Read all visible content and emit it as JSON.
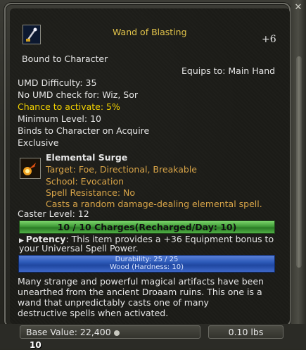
{
  "item": {
    "name": "Wand of Blasting",
    "plus": "+6",
    "bound": "Bound to Character",
    "equips": "Equips to: Main Hand",
    "umd_difficulty": "UMD Difficulty: 35",
    "no_umd": "No UMD check for: Wiz, Sor",
    "chance": "Chance to activate: 5%",
    "min_level": "Minimum Level: 10",
    "binds": "Binds to Character on Acquire",
    "exclusive": "Exclusive"
  },
  "spell": {
    "name": "Elemental Surge",
    "target": "Target: Foe, Directional, Breakable",
    "school": "School: Evocation",
    "resistance": "Spell Resistance: No",
    "description": "Casts a random damage-dealing elemental spell."
  },
  "caster_level": "Caster Level: 12",
  "charges": "10 / 10 Charges(Recharged/Day: 10)",
  "charges_fill": 1.0,
  "potency": {
    "label": "Potency",
    "text_line1": ": This item provides a +36 Equipment bonus to",
    "text_line2": "your Universal Spell Power."
  },
  "durability": {
    "line1": "Durability: 25 / 25",
    "line2": "Wood (Hardness: 10)",
    "fill": 1.0
  },
  "lore": [
    "Many strange and powerful magical artifacts have been",
    "unearthed from the ancient Droaam ruins. This one is a",
    "wand that unpredictably casts one of many",
    "destructive spells when activated."
  ],
  "footer": {
    "base_value": "Base Value: 22,400",
    "weight": "0.10 lbs",
    "stack": "10"
  },
  "colors": {
    "title": "#e0c24a",
    "chance": "#f2d200",
    "spell_detail": "#d8a448",
    "charges_bar": "#3e9a36",
    "durability_bar": "#2d5ab8"
  },
  "icons": {
    "item": "wand-icon",
    "spell": "fire-burst-icon",
    "close": "close-icon"
  }
}
